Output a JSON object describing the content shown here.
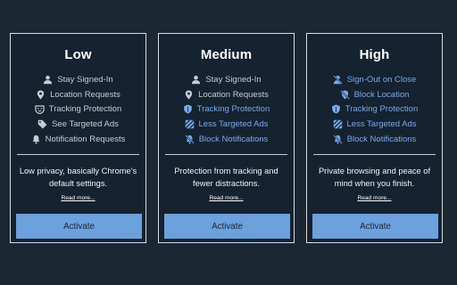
{
  "cards": [
    {
      "title": "Low",
      "features": [
        {
          "label": "Stay Signed-In",
          "icon": "user-icon",
          "style": "gray"
        },
        {
          "label": "Location Requests",
          "icon": "location-pin-icon",
          "style": "gray"
        },
        {
          "label": "Tracking Protection",
          "icon": "mask-icon",
          "style": "gray"
        },
        {
          "label": "See Targeted Ads",
          "icon": "tag-icon",
          "style": "gray"
        },
        {
          "label": "Notification Requests",
          "icon": "bell-icon",
          "style": "gray"
        }
      ],
      "description": "Low privacy, basically Chrome's default settings.",
      "read_more": "Read more...",
      "button": "Activate"
    },
    {
      "title": "Medium",
      "features": [
        {
          "label": "Stay Signed-In",
          "icon": "user-icon",
          "style": "gray"
        },
        {
          "label": "Location Requests",
          "icon": "location-pin-icon",
          "style": "gray"
        },
        {
          "label": "Tracking Protection",
          "icon": "shield-icon",
          "style": "blue"
        },
        {
          "label": "Less Targeted Ads",
          "icon": "striped-tag-icon",
          "style": "blue"
        },
        {
          "label": "Block Notifications",
          "icon": "bell-slash-icon",
          "style": "blue"
        }
      ],
      "description": "Protection from tracking and fewer distractions.",
      "read_more": "Read more...",
      "button": "Activate"
    },
    {
      "title": "High",
      "features": [
        {
          "label": "Sign-Out on Close",
          "icon": "user-slash-icon",
          "style": "blue"
        },
        {
          "label": "Block Location",
          "icon": "location-slash-icon",
          "style": "blue"
        },
        {
          "label": "Tracking Protection",
          "icon": "shield-icon",
          "style": "blue"
        },
        {
          "label": "Less Targeted Ads",
          "icon": "striped-tag-icon",
          "style": "blue"
        },
        {
          "label": "Block Notifications",
          "icon": "bell-slash-icon",
          "style": "blue"
        }
      ],
      "description": "Private browsing and peace of mind when you finish.",
      "read_more": "Read more...",
      "button": "Activate"
    }
  ],
  "colors": {
    "background": "#1b2733",
    "card_border": "#d8dde3",
    "feature_gray": "#c8ccd2",
    "feature_blue": "#79a9ea",
    "button_bg": "#6ca1dc",
    "button_text": "#1c2633"
  }
}
